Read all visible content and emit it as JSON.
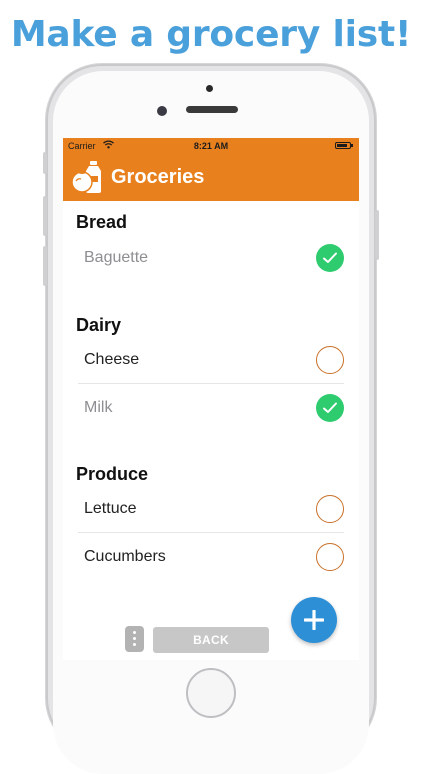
{
  "headline": "Make a grocery list!",
  "status_bar": {
    "carrier": "Carrier",
    "time": "8:21 AM"
  },
  "nav": {
    "title": "Groceries"
  },
  "sections": [
    {
      "title": "Bread",
      "items": [
        {
          "name": "Baguette",
          "checked": true
        }
      ]
    },
    {
      "title": "Dairy",
      "items": [
        {
          "name": "Cheese",
          "checked": false
        },
        {
          "name": "Milk",
          "checked": true
        }
      ]
    },
    {
      "title": "Produce",
      "items": [
        {
          "name": "Lettuce",
          "checked": false
        },
        {
          "name": "Cucumbers",
          "checked": false
        }
      ]
    }
  ],
  "buttons": {
    "back_label": "BACK"
  },
  "icons": {
    "app": "groceries-app-icon",
    "checked": "checkmark-icon",
    "unchecked": "empty-circle-icon",
    "add": "plus-icon",
    "more": "vertical-dots-icon",
    "wifi": "wifi-icon",
    "battery": "battery-icon"
  },
  "colors": {
    "headline": "#4aa0da",
    "nav_bar": "#e8801e",
    "check_on": "#2ecc6f",
    "check_off_border": "#c8712a",
    "fab": "#2d8fd6",
    "back_button": "#c7c7c7"
  }
}
